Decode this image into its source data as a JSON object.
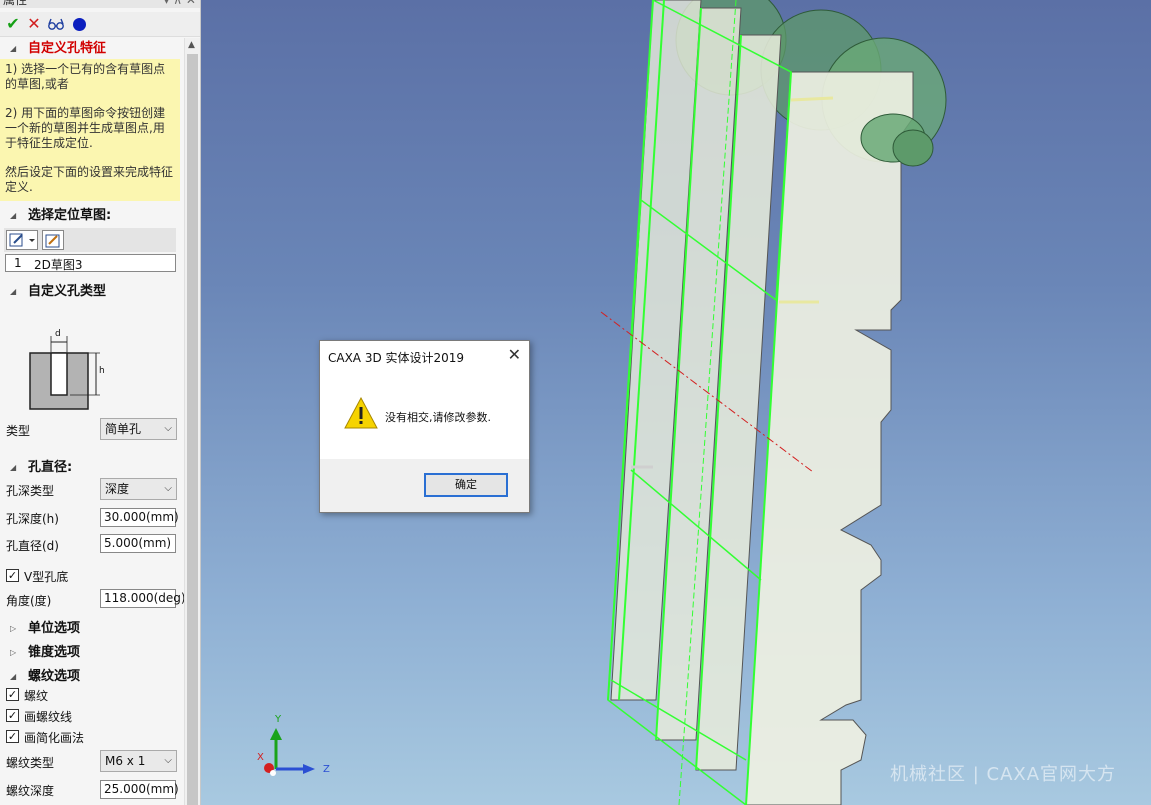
{
  "panel": {
    "title": "属性",
    "pin_glyphs": "▾ ⊼ ✕",
    "toolbar": {
      "ok_icon": "checkmark-icon",
      "cancel_icon": "close-icon",
      "preview_icon": "glasses-icon",
      "dot_icon": "blue-dot-icon"
    },
    "section_feature": "自定义孔特征",
    "hint_lines": [
      "1) 选择一个已有的含有草图点的草图,或者",
      "2) 用下面的草图命令按钮创建一个新的草图并生成草图点,用于特征生成定位.",
      "然后设定下面的设置来完成特征定义."
    ],
    "section_sketch": "选择定位草图:",
    "sketch_item_index": "1",
    "sketch_item_name": "2D草图3",
    "section_hole_type": "自定义孔类型",
    "diagram_d": "d",
    "diagram_h": "h",
    "type_label": "类型",
    "type_value": "简单孔",
    "section_diameter": "孔直径:",
    "depth_type_label": "孔深类型",
    "depth_type_value": "深度",
    "depth_label": "孔深度(h)",
    "depth_value": "30.000(mm)",
    "diameter_label": "孔直径(d)",
    "diameter_value": "5.000(mm)",
    "v_bottom_label": "V型孔底",
    "v_bottom_checked": true,
    "angle_label": "角度(度)",
    "angle_value": "118.000(deg)",
    "section_units": "单位选项",
    "section_taper": "锥度选项",
    "section_thread": "螺纹选项",
    "thread_label": "螺纹",
    "thread_lines_label": "画螺纹线",
    "simplified_label": "画简化画法",
    "thread_type_label": "螺纹类型",
    "thread_type_value": "M6 x 1",
    "thread_depth_label": "螺纹深度",
    "thread_depth_value": "25.000(mm)"
  },
  "dialog": {
    "title": "CAXA 3D 实体设计2019",
    "message": "没有相交,请修改参数.",
    "ok_label": "确定",
    "icon": "warning-icon"
  },
  "axes": {
    "y": "Y",
    "x": "X",
    "z": "Z"
  },
  "watermark": "机械社区 | CAXA官网大方",
  "colors": {
    "selection_green": "#33ff33",
    "dialog_accent": "#2a6fd3",
    "hint_bg": "#fbf6b0"
  }
}
